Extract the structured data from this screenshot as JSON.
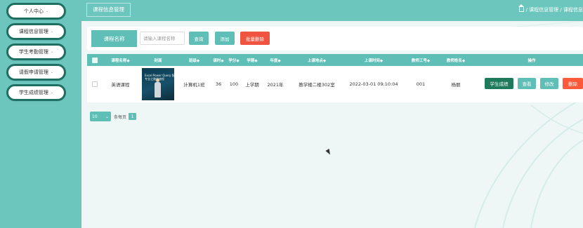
{
  "sidebar": {
    "items": [
      {
        "label": "个人中心"
      },
      {
        "label": "课程信息管理"
      },
      {
        "label": "学生考勤管理"
      },
      {
        "label": "请假申请管理"
      },
      {
        "label": "学生成绩管理"
      }
    ]
  },
  "header": {
    "title": "课程信息管理",
    "breadcrumb": "/ 课程信息管理 / 课程信息"
  },
  "search": {
    "label": "课程名称",
    "placeholder": "请输入课程名称",
    "value": "",
    "query_button": "查询",
    "add_button": "添加",
    "batch_delete_button": "批量删除"
  },
  "table": {
    "headers": {
      "course_name": "课程名称◆",
      "cover": "封面",
      "class": "班级◆",
      "hours": "课时◆",
      "credit": "学分◆",
      "term": "学期◆",
      "year": "年度◆",
      "location": "上课地点◆",
      "time": "上课时间◆",
      "teacher_id": "教师工号◆",
      "teacher_name": "教师姓名◆",
      "actions": "操作"
    },
    "rows": [
      {
        "course_name": "英语课程",
        "cover_text": "Excel Power Query 智能\n专业之路的旅程",
        "class": "计算机1班",
        "hours": "36",
        "credit": "100",
        "term": "上学期",
        "year": "2021年",
        "location": "教学楼二楼302室",
        "time": "2022-03-01 09:10:04",
        "teacher_id": "001",
        "teacher_name": "杨丽",
        "actions": {
          "grades": "学生成绩",
          "view": "查看",
          "edit": "修改",
          "delete": "删除"
        }
      }
    ]
  },
  "pager": {
    "page_size": "10",
    "per_page_text": "条每页",
    "current_page": "1"
  },
  "colors": {
    "teal": "#5fbfb6",
    "dark_green": "#1f7a5c",
    "red": "#f0533f",
    "orange": "#ff5a3c",
    "background": "#eef7f5"
  }
}
